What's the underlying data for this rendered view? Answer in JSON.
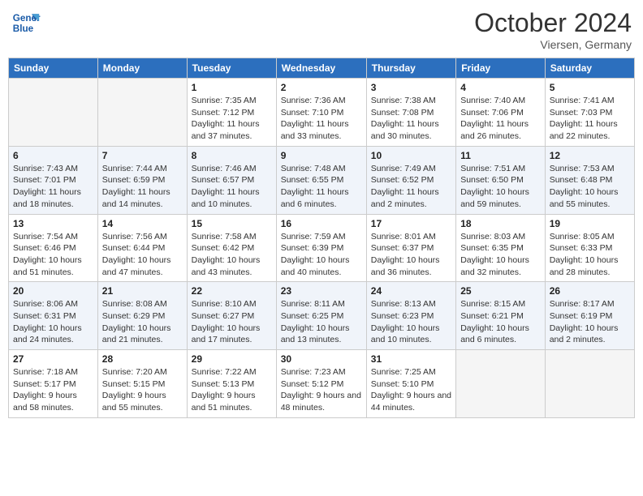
{
  "logo": {
    "line1": "General",
    "line2": "Blue"
  },
  "title": "October 2024",
  "location": "Viersen, Germany",
  "weekdays": [
    "Sunday",
    "Monday",
    "Tuesday",
    "Wednesday",
    "Thursday",
    "Friday",
    "Saturday"
  ],
  "weeks": [
    [
      {
        "day": "",
        "info": ""
      },
      {
        "day": "",
        "info": ""
      },
      {
        "day": "1",
        "sunrise": "7:35 AM",
        "sunset": "7:12 PM",
        "daylight": "11 hours and 37 minutes."
      },
      {
        "day": "2",
        "sunrise": "7:36 AM",
        "sunset": "7:10 PM",
        "daylight": "11 hours and 33 minutes."
      },
      {
        "day": "3",
        "sunrise": "7:38 AM",
        "sunset": "7:08 PM",
        "daylight": "11 hours and 30 minutes."
      },
      {
        "day": "4",
        "sunrise": "7:40 AM",
        "sunset": "7:06 PM",
        "daylight": "11 hours and 26 minutes."
      },
      {
        "day": "5",
        "sunrise": "7:41 AM",
        "sunset": "7:03 PM",
        "daylight": "11 hours and 22 minutes."
      }
    ],
    [
      {
        "day": "6",
        "sunrise": "7:43 AM",
        "sunset": "7:01 PM",
        "daylight": "11 hours and 18 minutes."
      },
      {
        "day": "7",
        "sunrise": "7:44 AM",
        "sunset": "6:59 PM",
        "daylight": "11 hours and 14 minutes."
      },
      {
        "day": "8",
        "sunrise": "7:46 AM",
        "sunset": "6:57 PM",
        "daylight": "11 hours and 10 minutes."
      },
      {
        "day": "9",
        "sunrise": "7:48 AM",
        "sunset": "6:55 PM",
        "daylight": "11 hours and 6 minutes."
      },
      {
        "day": "10",
        "sunrise": "7:49 AM",
        "sunset": "6:52 PM",
        "daylight": "11 hours and 2 minutes."
      },
      {
        "day": "11",
        "sunrise": "7:51 AM",
        "sunset": "6:50 PM",
        "daylight": "10 hours and 59 minutes."
      },
      {
        "day": "12",
        "sunrise": "7:53 AM",
        "sunset": "6:48 PM",
        "daylight": "10 hours and 55 minutes."
      }
    ],
    [
      {
        "day": "13",
        "sunrise": "7:54 AM",
        "sunset": "6:46 PM",
        "daylight": "10 hours and 51 minutes."
      },
      {
        "day": "14",
        "sunrise": "7:56 AM",
        "sunset": "6:44 PM",
        "daylight": "10 hours and 47 minutes."
      },
      {
        "day": "15",
        "sunrise": "7:58 AM",
        "sunset": "6:42 PM",
        "daylight": "10 hours and 43 minutes."
      },
      {
        "day": "16",
        "sunrise": "7:59 AM",
        "sunset": "6:39 PM",
        "daylight": "10 hours and 40 minutes."
      },
      {
        "day": "17",
        "sunrise": "8:01 AM",
        "sunset": "6:37 PM",
        "daylight": "10 hours and 36 minutes."
      },
      {
        "day": "18",
        "sunrise": "8:03 AM",
        "sunset": "6:35 PM",
        "daylight": "10 hours and 32 minutes."
      },
      {
        "day": "19",
        "sunrise": "8:05 AM",
        "sunset": "6:33 PM",
        "daylight": "10 hours and 28 minutes."
      }
    ],
    [
      {
        "day": "20",
        "sunrise": "8:06 AM",
        "sunset": "6:31 PM",
        "daylight": "10 hours and 24 minutes."
      },
      {
        "day": "21",
        "sunrise": "8:08 AM",
        "sunset": "6:29 PM",
        "daylight": "10 hours and 21 minutes."
      },
      {
        "day": "22",
        "sunrise": "8:10 AM",
        "sunset": "6:27 PM",
        "daylight": "10 hours and 17 minutes."
      },
      {
        "day": "23",
        "sunrise": "8:11 AM",
        "sunset": "6:25 PM",
        "daylight": "10 hours and 13 minutes."
      },
      {
        "day": "24",
        "sunrise": "8:13 AM",
        "sunset": "6:23 PM",
        "daylight": "10 hours and 10 minutes."
      },
      {
        "day": "25",
        "sunrise": "8:15 AM",
        "sunset": "6:21 PM",
        "daylight": "10 hours and 6 minutes."
      },
      {
        "day": "26",
        "sunrise": "8:17 AM",
        "sunset": "6:19 PM",
        "daylight": "10 hours and 2 minutes."
      }
    ],
    [
      {
        "day": "27",
        "sunrise": "7:18 AM",
        "sunset": "5:17 PM",
        "daylight": "9 hours and 58 minutes."
      },
      {
        "day": "28",
        "sunrise": "7:20 AM",
        "sunset": "5:15 PM",
        "daylight": "9 hours and 55 minutes."
      },
      {
        "day": "29",
        "sunrise": "7:22 AM",
        "sunset": "5:13 PM",
        "daylight": "9 hours and 51 minutes."
      },
      {
        "day": "30",
        "sunrise": "7:23 AM",
        "sunset": "5:12 PM",
        "daylight": "9 hours and 48 minutes."
      },
      {
        "day": "31",
        "sunrise": "7:25 AM",
        "sunset": "5:10 PM",
        "daylight": "9 hours and 44 minutes."
      },
      {
        "day": "",
        "info": ""
      },
      {
        "day": "",
        "info": ""
      }
    ]
  ]
}
